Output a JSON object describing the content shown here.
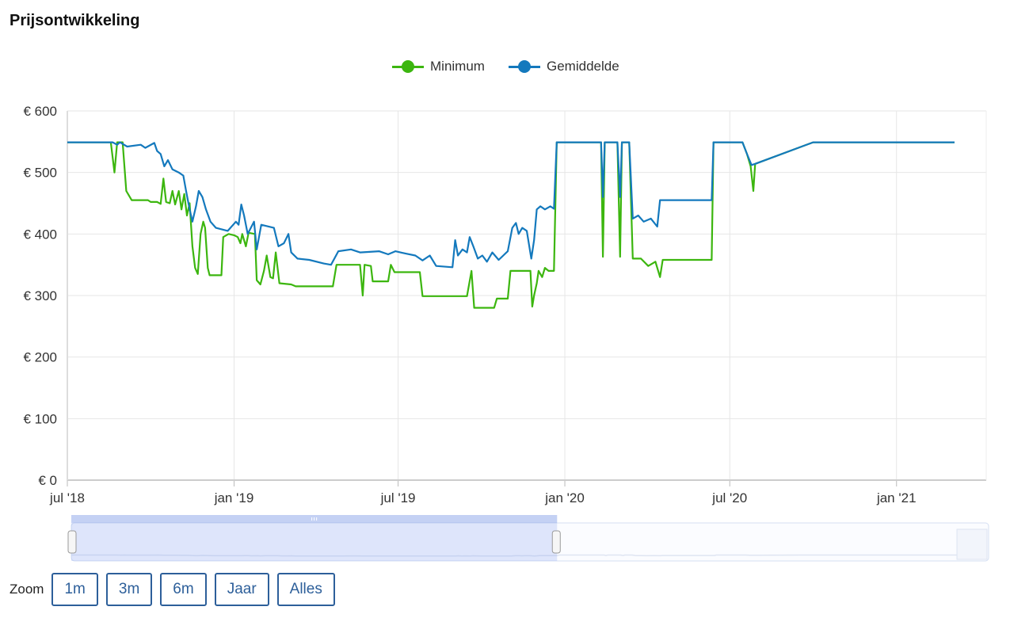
{
  "title": "Prijsontwikkeling",
  "legend": [
    {
      "label": "Minimum",
      "color": "#3cb60f"
    },
    {
      "label": "Gemiddelde",
      "color": "#1479bd"
    }
  ],
  "zoom": {
    "label": "Zoom",
    "buttons": [
      "1m",
      "3m",
      "6m",
      "Jaar",
      "Alles"
    ]
  },
  "chart_data": {
    "type": "line",
    "title": "Prijsontwikkeling",
    "xlabel": "",
    "ylabel": "",
    "ylim": [
      0,
      600
    ],
    "xlim": [
      "2018-07-01",
      "2021-04-10"
    ],
    "y_ticks": [
      "€ 0",
      "€ 100",
      "€ 200",
      "€ 300",
      "€ 400",
      "€ 500",
      "€ 600"
    ],
    "x_ticks": [
      {
        "label": "jul '18",
        "date": "2018-07-01"
      },
      {
        "label": "jan '19",
        "date": "2019-01-01"
      },
      {
        "label": "jul '19",
        "date": "2019-07-01"
      },
      {
        "label": "jan '20",
        "date": "2020-01-01"
      },
      {
        "label": "jul '20",
        "date": "2020-07-01"
      },
      {
        "label": "jan '21",
        "date": "2021-01-01"
      }
    ],
    "grid": true,
    "legend_position": "top-center",
    "series": [
      {
        "name": "Minimum",
        "color": "#3cb60f",
        "points": [
          [
            "2018-07-01",
            549
          ],
          [
            "2018-08-18",
            549
          ],
          [
            "2018-08-22",
            500
          ],
          [
            "2018-08-25",
            549
          ],
          [
            "2018-08-31",
            549
          ],
          [
            "2018-09-04",
            470
          ],
          [
            "2018-09-10",
            455
          ],
          [
            "2018-09-28",
            455
          ],
          [
            "2018-10-01",
            452
          ],
          [
            "2018-10-08",
            452
          ],
          [
            "2018-10-12",
            449
          ],
          [
            "2018-10-15",
            490
          ],
          [
            "2018-10-18",
            452
          ],
          [
            "2018-10-22",
            450
          ],
          [
            "2018-10-25",
            470
          ],
          [
            "2018-10-28",
            448
          ],
          [
            "2018-11-01",
            470
          ],
          [
            "2018-11-04",
            440
          ],
          [
            "2018-11-07",
            465
          ],
          [
            "2018-11-10",
            430
          ],
          [
            "2018-11-13",
            450
          ],
          [
            "2018-11-16",
            380
          ],
          [
            "2018-11-19",
            345
          ],
          [
            "2018-11-22",
            335
          ],
          [
            "2018-11-25",
            400
          ],
          [
            "2018-11-28",
            420
          ],
          [
            "2018-11-30",
            410
          ],
          [
            "2018-12-03",
            345
          ],
          [
            "2018-12-05",
            333
          ],
          [
            "2018-12-18",
            333
          ],
          [
            "2018-12-20",
            395
          ],
          [
            "2018-12-26",
            400
          ],
          [
            "2019-01-01",
            398
          ],
          [
            "2019-01-05",
            395
          ],
          [
            "2019-01-08",
            385
          ],
          [
            "2019-01-10",
            400
          ],
          [
            "2019-01-14",
            380
          ],
          [
            "2019-01-17",
            402
          ],
          [
            "2019-01-24",
            400
          ],
          [
            "2019-01-26",
            325
          ],
          [
            "2019-01-30",
            318
          ],
          [
            "2019-02-03",
            340
          ],
          [
            "2019-02-06",
            365
          ],
          [
            "2019-02-10",
            330
          ],
          [
            "2019-02-13",
            328
          ],
          [
            "2019-02-16",
            370
          ],
          [
            "2019-02-20",
            320
          ],
          [
            "2019-03-05",
            318
          ],
          [
            "2019-03-10",
            315
          ],
          [
            "2019-04-20",
            315
          ],
          [
            "2019-04-24",
            350
          ],
          [
            "2019-05-20",
            350
          ],
          [
            "2019-05-23",
            300
          ],
          [
            "2019-05-25",
            350
          ],
          [
            "2019-06-01",
            348
          ],
          [
            "2019-06-03",
            323
          ],
          [
            "2019-06-20",
            323
          ],
          [
            "2019-06-23",
            350
          ],
          [
            "2019-06-27",
            338
          ],
          [
            "2019-07-25",
            338
          ],
          [
            "2019-07-28",
            299
          ],
          [
            "2019-09-15",
            299
          ],
          [
            "2019-09-20",
            340
          ],
          [
            "2019-09-23",
            280
          ],
          [
            "2019-10-15",
            280
          ],
          [
            "2019-10-18",
            295
          ],
          [
            "2019-10-30",
            295
          ],
          [
            "2019-11-02",
            340
          ],
          [
            "2019-11-24",
            340
          ],
          [
            "2019-11-26",
            282
          ],
          [
            "2019-11-28",
            300
          ],
          [
            "2019-12-01",
            320
          ],
          [
            "2019-12-03",
            340
          ],
          [
            "2019-12-07",
            330
          ],
          [
            "2019-12-10",
            345
          ],
          [
            "2019-12-14",
            340
          ],
          [
            "2019-12-20",
            340
          ],
          [
            "2019-12-23",
            549
          ],
          [
            "2020-02-10",
            549
          ],
          [
            "2020-02-12",
            363
          ],
          [
            "2020-02-14",
            549
          ],
          [
            "2020-02-28",
            549
          ],
          [
            "2020-03-02",
            363
          ],
          [
            "2020-03-04",
            549
          ],
          [
            "2020-03-12",
            549
          ],
          [
            "2020-03-16",
            360
          ],
          [
            "2020-03-25",
            360
          ],
          [
            "2020-04-02",
            348
          ],
          [
            "2020-04-10",
            355
          ],
          [
            "2020-04-15",
            330
          ],
          [
            "2020-04-18",
            358
          ],
          [
            "2020-06-11",
            358
          ],
          [
            "2020-06-13",
            549
          ],
          [
            "2020-07-15",
            549
          ],
          [
            "2020-07-20",
            530
          ],
          [
            "2020-07-24",
            510
          ],
          [
            "2020-07-27",
            470
          ],
          [
            "2020-07-29",
            514
          ],
          [
            "2020-10-01",
            549
          ],
          [
            "2021-03-06",
            549
          ]
        ]
      },
      {
        "name": "Gemiddelde",
        "color": "#1479bd",
        "points": [
          [
            "2018-07-01",
            549
          ],
          [
            "2018-08-20",
            549
          ],
          [
            "2018-08-25",
            545
          ],
          [
            "2018-08-28",
            549
          ],
          [
            "2018-09-05",
            542
          ],
          [
            "2018-09-20",
            545
          ],
          [
            "2018-09-25",
            540
          ],
          [
            "2018-10-05",
            548
          ],
          [
            "2018-10-08",
            535
          ],
          [
            "2018-10-12",
            530
          ],
          [
            "2018-10-16",
            510
          ],
          [
            "2018-10-20",
            520
          ],
          [
            "2018-10-25",
            505
          ],
          [
            "2018-11-01",
            500
          ],
          [
            "2018-11-06",
            495
          ],
          [
            "2018-11-09",
            470
          ],
          [
            "2018-11-13",
            440
          ],
          [
            "2018-11-16",
            420
          ],
          [
            "2018-11-20",
            445
          ],
          [
            "2018-11-23",
            470
          ],
          [
            "2018-11-27",
            460
          ],
          [
            "2018-12-01",
            440
          ],
          [
            "2018-12-06",
            420
          ],
          [
            "2018-12-12",
            410
          ],
          [
            "2018-12-25",
            405
          ],
          [
            "2019-01-03",
            420
          ],
          [
            "2019-01-06",
            415
          ],
          [
            "2019-01-09",
            448
          ],
          [
            "2019-01-12",
            430
          ],
          [
            "2019-01-16",
            400
          ],
          [
            "2019-01-23",
            420
          ],
          [
            "2019-01-26",
            375
          ],
          [
            "2019-01-31",
            415
          ],
          [
            "2019-02-14",
            410
          ],
          [
            "2019-02-19",
            380
          ],
          [
            "2019-02-25",
            385
          ],
          [
            "2019-03-02",
            400
          ],
          [
            "2019-03-05",
            370
          ],
          [
            "2019-03-12",
            360
          ],
          [
            "2019-03-25",
            358
          ],
          [
            "2019-04-10",
            352
          ],
          [
            "2019-04-18",
            350
          ],
          [
            "2019-04-26",
            372
          ],
          [
            "2019-05-10",
            375
          ],
          [
            "2019-05-20",
            370
          ],
          [
            "2019-06-10",
            372
          ],
          [
            "2019-06-20",
            367
          ],
          [
            "2019-06-28",
            372
          ],
          [
            "2019-07-10",
            368
          ],
          [
            "2019-07-20",
            365
          ],
          [
            "2019-07-28",
            357
          ],
          [
            "2019-08-05",
            365
          ],
          [
            "2019-08-12",
            348
          ],
          [
            "2019-08-30",
            346
          ],
          [
            "2019-09-02",
            390
          ],
          [
            "2019-09-05",
            365
          ],
          [
            "2019-09-10",
            375
          ],
          [
            "2019-09-15",
            370
          ],
          [
            "2019-09-18",
            395
          ],
          [
            "2019-09-22",
            380
          ],
          [
            "2019-09-27",
            360
          ],
          [
            "2019-10-02",
            365
          ],
          [
            "2019-10-07",
            355
          ],
          [
            "2019-10-13",
            370
          ],
          [
            "2019-10-20",
            358
          ],
          [
            "2019-10-30",
            372
          ],
          [
            "2019-11-04",
            410
          ],
          [
            "2019-11-08",
            418
          ],
          [
            "2019-11-11",
            400
          ],
          [
            "2019-11-15",
            410
          ],
          [
            "2019-11-20",
            405
          ],
          [
            "2019-11-25",
            360
          ],
          [
            "2019-11-28",
            390
          ],
          [
            "2019-12-01",
            440
          ],
          [
            "2019-12-05",
            445
          ],
          [
            "2019-12-10",
            440
          ],
          [
            "2019-12-16",
            445
          ],
          [
            "2019-12-20",
            441
          ],
          [
            "2019-12-23",
            549
          ],
          [
            "2020-02-10",
            549
          ],
          [
            "2020-02-12",
            460
          ],
          [
            "2020-02-14",
            549
          ],
          [
            "2020-02-28",
            549
          ],
          [
            "2020-03-02",
            460
          ],
          [
            "2020-03-04",
            549
          ],
          [
            "2020-03-12",
            549
          ],
          [
            "2020-03-16",
            425
          ],
          [
            "2020-03-22",
            430
          ],
          [
            "2020-03-28",
            420
          ],
          [
            "2020-04-05",
            425
          ],
          [
            "2020-04-12",
            412
          ],
          [
            "2020-04-15",
            455
          ],
          [
            "2020-06-11",
            455
          ],
          [
            "2020-06-13",
            549
          ],
          [
            "2020-07-15",
            549
          ],
          [
            "2020-07-20",
            530
          ],
          [
            "2020-07-25",
            512
          ],
          [
            "2020-07-29",
            514
          ],
          [
            "2020-10-01",
            549
          ],
          [
            "2021-03-06",
            549
          ]
        ]
      }
    ],
    "navigator": {
      "selected_range": [
        "2018-07-01",
        "2019-12-20"
      ]
    }
  }
}
